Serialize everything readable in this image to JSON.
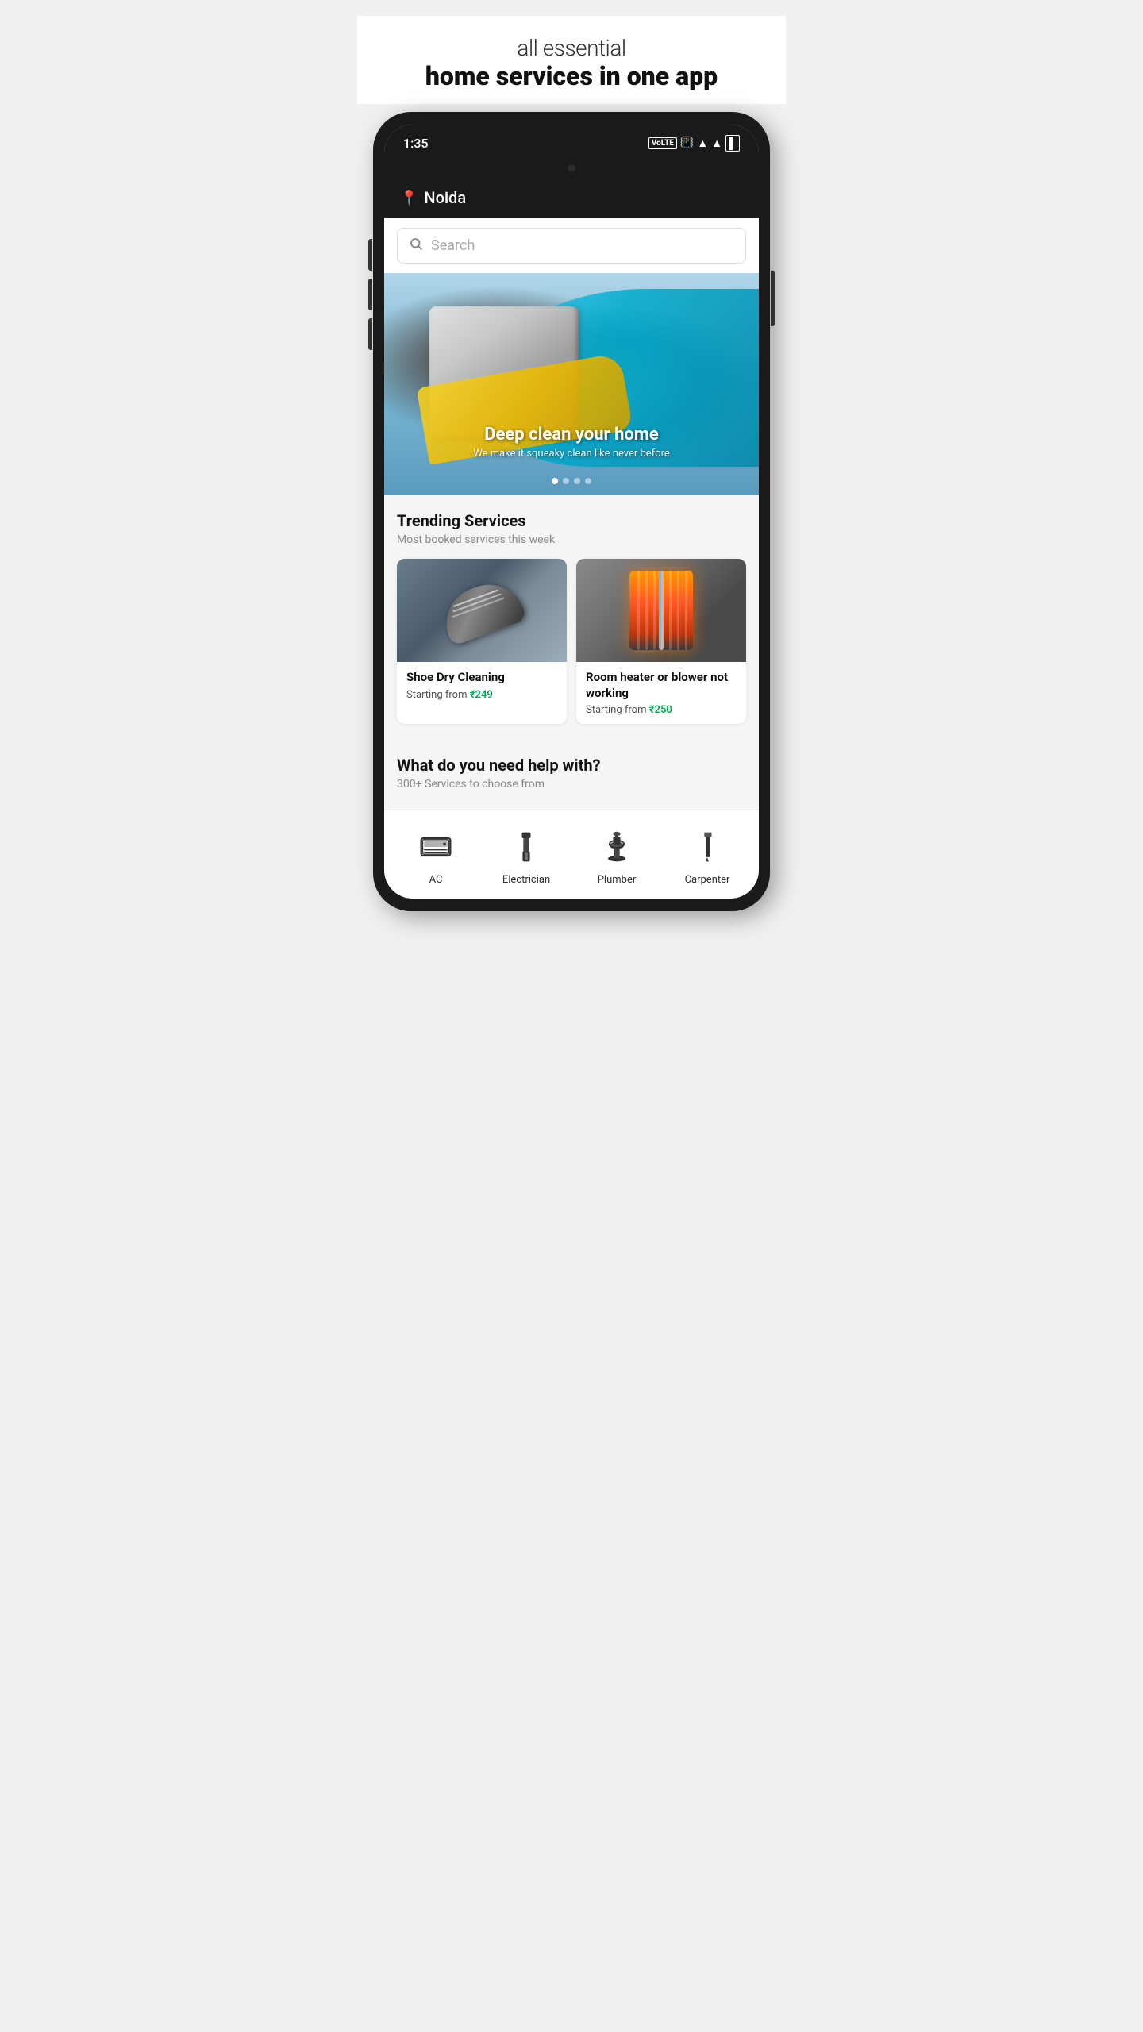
{
  "page": {
    "tagline_light": "all essential",
    "tagline_bold": "home services in one app"
  },
  "status_bar": {
    "time": "1:35",
    "network": "VoLTE",
    "signal_bars": "▲",
    "wifi": "▲",
    "battery": "▌"
  },
  "header": {
    "location": "Noida"
  },
  "search": {
    "placeholder": "Search"
  },
  "hero": {
    "title": "Deep clean your home",
    "subtitle": "We make it squeaky clean like never before",
    "dots": [
      true,
      false,
      false,
      false
    ]
  },
  "trending": {
    "title": "Trending Services",
    "subtitle": "Most booked services this week",
    "services": [
      {
        "name": "Shoe Dry Cleaning",
        "starting_label": "Starting from",
        "price": "₹249"
      },
      {
        "name": "Room heater or blower not working",
        "starting_label": "Starting from",
        "price": "₹250"
      }
    ]
  },
  "help_section": {
    "title": "What do you need help with?",
    "subtitle": "300+ Services to choose from"
  },
  "categories": [
    {
      "id": "ac",
      "label": "AC"
    },
    {
      "id": "electrician",
      "label": "Electrician"
    },
    {
      "id": "plumber",
      "label": "Plumber"
    },
    {
      "id": "carpenter",
      "label": "Carpenter"
    }
  ]
}
